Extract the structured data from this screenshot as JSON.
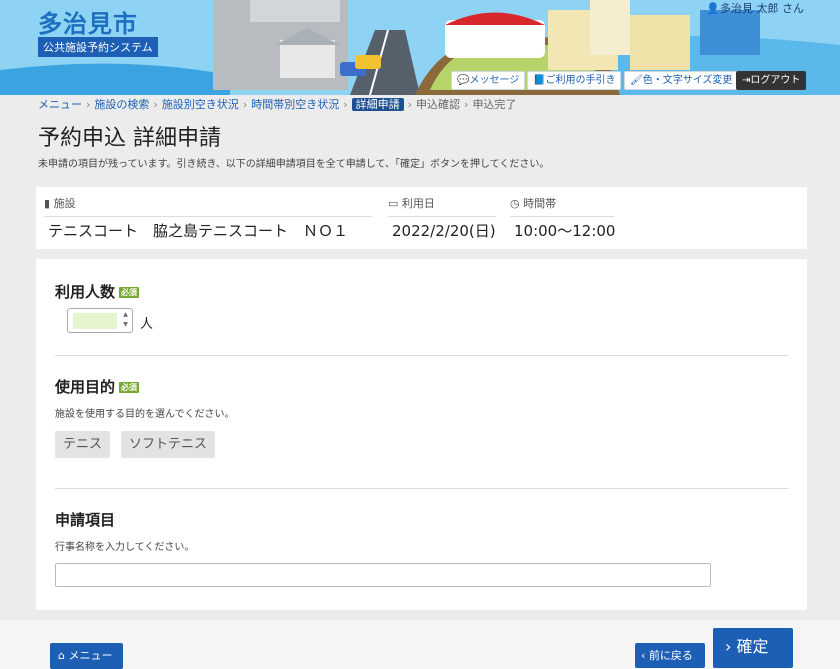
{
  "header": {
    "city_name": "多治見市",
    "system_name": "公共施設予約システム",
    "user_name": "多治見 太郎 さん",
    "buttons": {
      "message": "メッセージ",
      "guide": "ご利用の手引き",
      "color_size": "色・文字サイズ変更",
      "logout": "ログアウト"
    }
  },
  "breadcrumb": {
    "items": [
      "メニュー",
      "施設の検索",
      "施設別空き状況",
      "時間帯別空き状況"
    ],
    "current": "詳細申請",
    "future": [
      "申込確認",
      "申込完了"
    ]
  },
  "page": {
    "title": "予約申込 詳細申請",
    "description": "未申請の項目が残っています。引き続き、以下の詳細申請項目を全て申請して、「確定」ボタンを押してください。"
  },
  "summary": {
    "facility_label": "施設",
    "facility_value": "テニスコート　脇之島テニスコート　ＮＯ１",
    "date_label": "利用日",
    "date_value": "2022/2/20(日)",
    "time_label": "時間帯",
    "time_value": "10:00〜12:00"
  },
  "form": {
    "required_badge": "必須",
    "people": {
      "label": "利用人数",
      "value": "",
      "unit": "人"
    },
    "purpose": {
      "label": "使用目的",
      "hint": "施設を使用する目的を選んでください。",
      "options": [
        "テニス",
        "ソフトテニス"
      ]
    },
    "application": {
      "label": "申請項目",
      "hint": "行事名称を入力してください。",
      "value": ""
    }
  },
  "footer": {
    "menu": "メニュー",
    "back": "前に戻る",
    "confirm": "確定"
  },
  "colors": {
    "primary": "#1d5fb5",
    "required": "#77a830",
    "header_sky": "#8fd3f4"
  }
}
